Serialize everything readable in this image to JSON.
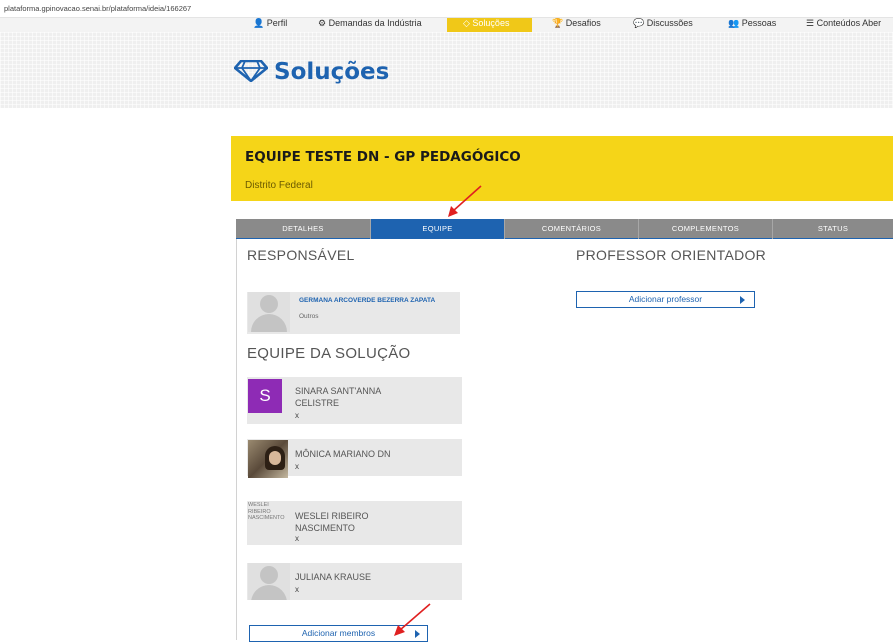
{
  "browser": {
    "url": "plataforma.gpinovacao.senai.br/plataforma/ideia/166267"
  },
  "topnav": {
    "items": [
      {
        "label": "👤 Perfil"
      },
      {
        "label": "⚙ Demandas da Indústria"
      },
      {
        "label": "◇ Soluções"
      },
      {
        "label": "🏆 Desafios"
      },
      {
        "label": "💬 Discussões"
      },
      {
        "label": "👥 Pessoas"
      },
      {
        "label": "☰ Conteúdos Aber"
      }
    ]
  },
  "banner": {
    "title": "Soluções"
  },
  "team": {
    "title": "EQUIPE TESTE DN - GP PEDAGÓGICO",
    "region": "Distrito Federal"
  },
  "tabs": [
    "DETALHES",
    "EQUIPE",
    "COMENTÁRIOS",
    "COMPLEMENTOS",
    "STATUS"
  ],
  "responsavel": {
    "heading": "RESPONSÁVEL",
    "name": "GERMANA ARCOVERDE BEZERRA ZAPATA",
    "role": "Outros"
  },
  "orientador": {
    "heading": "PROFESSOR ORIENTADOR",
    "button": "Adicionar professor"
  },
  "equipe": {
    "heading": "EQUIPE DA SOLUÇÃO",
    "members": [
      {
        "name": "SINARA SANT'ANNA CELISTRE",
        "remove": "x",
        "avatar_letter": "S"
      },
      {
        "name": "MÔNICA MARIANO DN",
        "remove": "x"
      },
      {
        "name": "WESLEI RIBEIRO NASCIMENTO",
        "remove": "x",
        "broken_img_alt": "WESLEI RIBEIRO NASCIMENTO"
      },
      {
        "name": "JULIANA KRAUSE",
        "remove": "x"
      }
    ],
    "add_button": "Adicionar membros"
  },
  "colors": {
    "brand_blue": "#1e63b0",
    "yellow": "#f5d518",
    "tab_grey": "#8a8a8a",
    "annotation_red": "#e02020"
  }
}
